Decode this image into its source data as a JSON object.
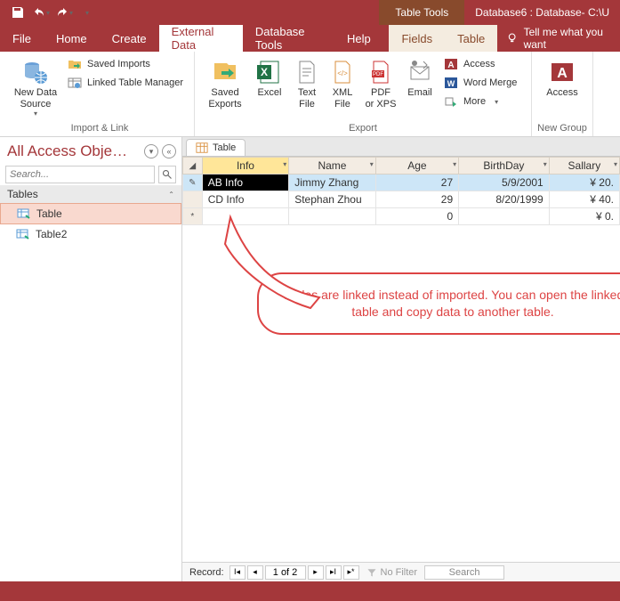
{
  "titlebar": {
    "context_tool_label": "Table Tools",
    "db_title": "Database6 : Database- C:\\U"
  },
  "tabs": {
    "file": "File",
    "home": "Home",
    "create": "Create",
    "external_data": "External Data",
    "database_tools": "Database Tools",
    "help": "Help",
    "fields": "Fields",
    "table": "Table",
    "tell_me": "Tell me what you want"
  },
  "ribbon": {
    "group_import": "Import & Link",
    "group_export": "Export",
    "group_new": "New Group",
    "new_data_source": "New Data\nSource",
    "saved_imports": "Saved Imports",
    "linked_table_mgr": "Linked Table Manager",
    "saved_exports": "Saved\nExports",
    "excel": "Excel",
    "text_file": "Text\nFile",
    "xml_file": "XML\nFile",
    "pdf_xps": "PDF\nor XPS",
    "email": "Email",
    "access": "Access",
    "word_merge": "Word Merge",
    "more": "More",
    "access_big": "Access"
  },
  "nav": {
    "title": "All Access Obje…",
    "search_placeholder": "Search...",
    "group_tables": "Tables",
    "items": [
      {
        "label": "Table"
      },
      {
        "label": "Table2"
      }
    ]
  },
  "doc_tab": "Table",
  "columns": [
    "Info",
    "Name",
    "Age",
    "BirthDay",
    "Sallary"
  ],
  "rows": [
    {
      "info": "AB Info",
      "name": "Jimmy Zhang",
      "age": "27",
      "birthday": "5/9/2001",
      "salary": "¥ 20."
    },
    {
      "info": "CD Info",
      "name": "Stephan Zhou",
      "age": "29",
      "birthday": "8/20/1999",
      "salary": "¥ 40."
    }
  ],
  "new_row": {
    "age": "0",
    "salary": "¥ 0."
  },
  "callout": "Tables are linked instead of imported. You can open the linked table and copy data to another table.",
  "recnav": {
    "label": "Record:",
    "pos": "1 of 2",
    "no_filter": "No Filter",
    "search": "Search"
  }
}
